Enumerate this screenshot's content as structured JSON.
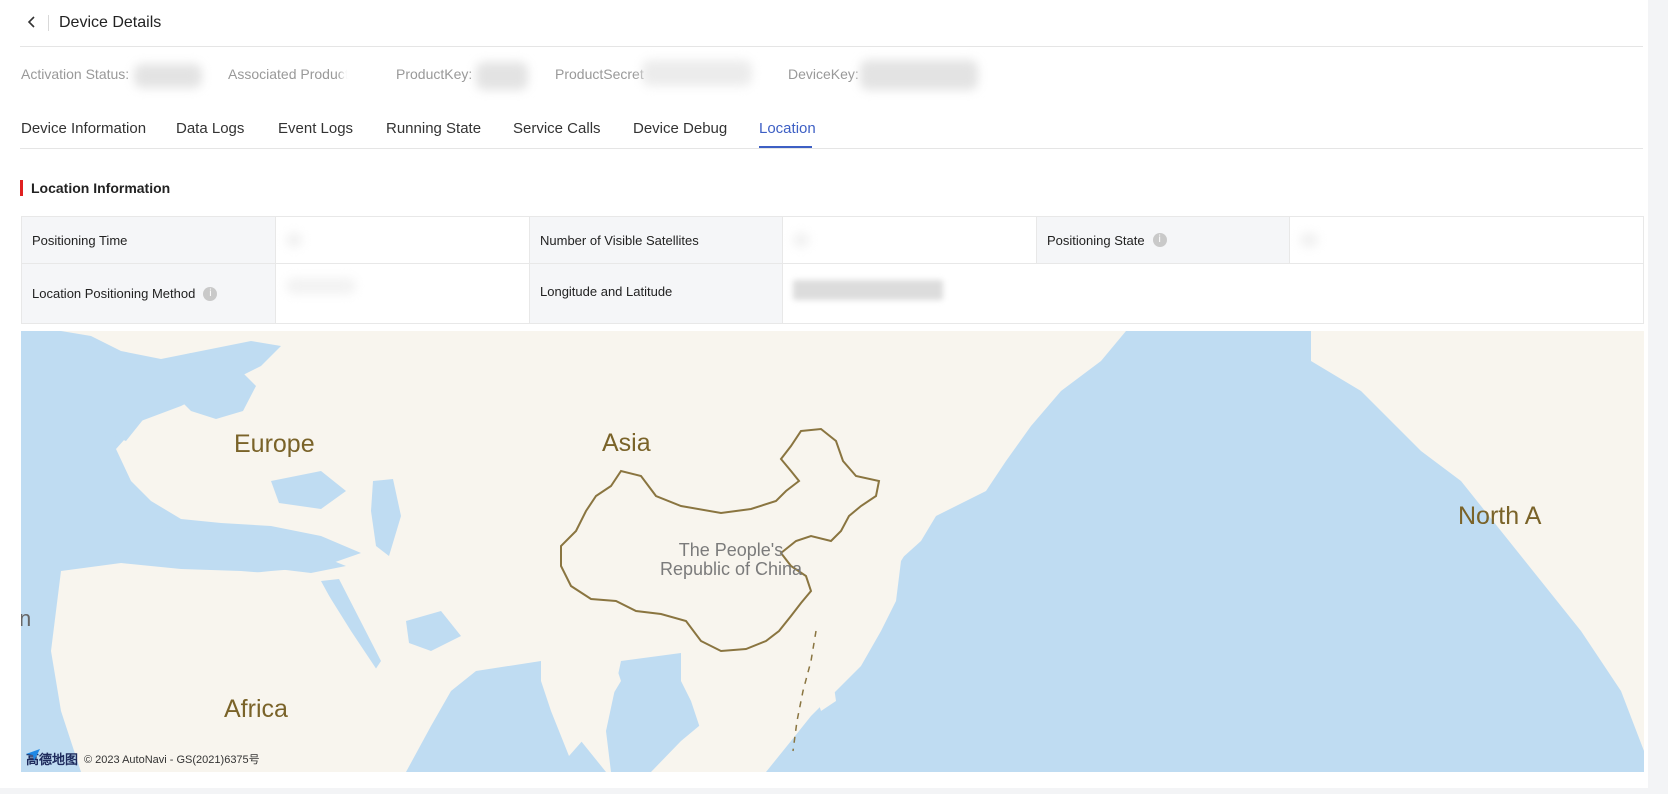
{
  "header": {
    "title": "Device Details"
  },
  "meta": {
    "activation_status": "Activation Status:",
    "associated_product": "Associated Product",
    "product_key": "ProductKey:",
    "product_secret": "ProductSecret",
    "device_key": "DeviceKey:"
  },
  "tabs": [
    {
      "label": "Device Information"
    },
    {
      "label": "Data Logs"
    },
    {
      "label": "Event Logs"
    },
    {
      "label": "Running State"
    },
    {
      "label": "Service Calls"
    },
    {
      "label": "Device Debug"
    },
    {
      "label": "Location",
      "active": true
    }
  ],
  "section": {
    "title": "Location Information"
  },
  "info": {
    "positioning_time": "Positioning Time",
    "visible_satellites": "Number of Visible Satellites",
    "positioning_state": "Positioning State",
    "positioning_method": "Location Positioning Method",
    "lon_lat": "Longitude and Latitude",
    "info_icon": "i"
  },
  "map": {
    "labels": {
      "europe": "Europe",
      "asia": "Asia",
      "africa": "Africa",
      "north_america": "North A",
      "left_edge": "n",
      "china_line1": "The People's",
      "china_line2": "Republic of China"
    },
    "attribution_logo": "高德地图",
    "attribution": "© 2023 AutoNavi - GS(2021)6375号"
  },
  "colors": {
    "accent": "#3d5fc4",
    "section_marker": "#e02020",
    "water": "#bfdcf2",
    "land": "#f8f5ee",
    "border": "#8a7540"
  }
}
